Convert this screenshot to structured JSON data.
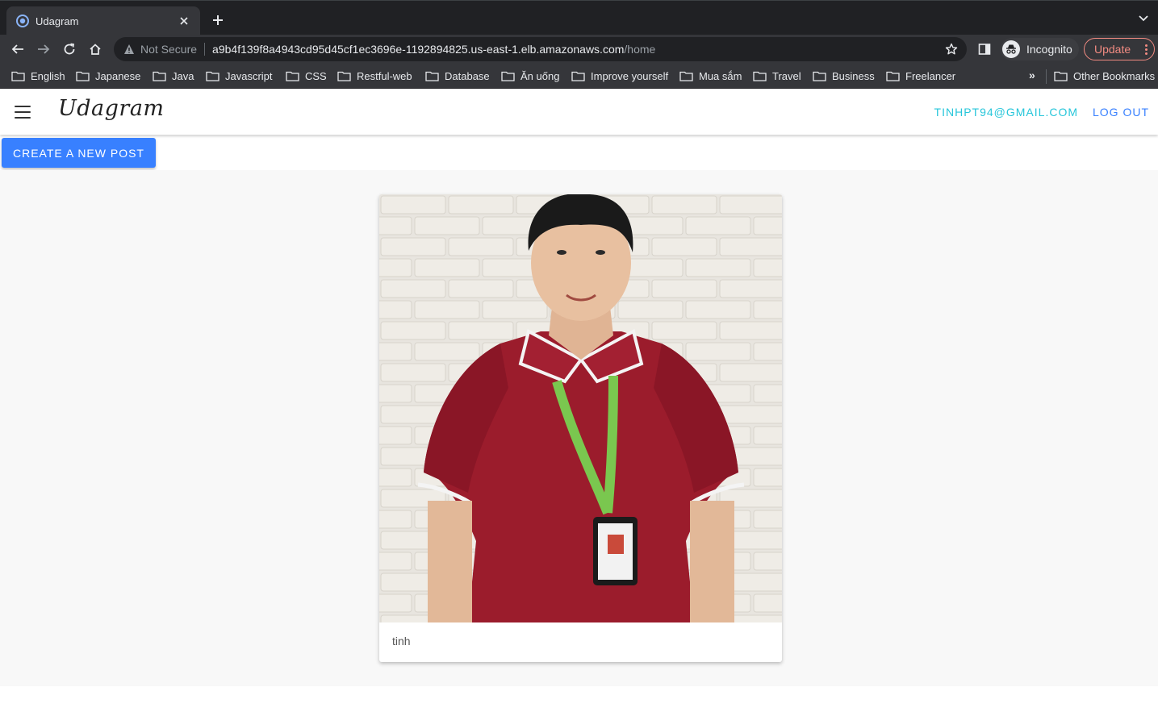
{
  "browser": {
    "tab_title": "Udagram",
    "security_label": "Not Secure",
    "url_host": "a9b4f139f8a4943cd95d45cf1ec3696e-1192894825.us-east-1.elb.amazonaws.com",
    "url_path": "/home",
    "profile_label": "Incognito",
    "update_label": "Update",
    "bookmarks": [
      "English",
      "Japanese",
      "Java",
      "Javascript",
      "CSS",
      "Restful-web",
      "Database",
      "Ăn uống",
      "Improve yourself",
      "Mua sắm",
      "Travel",
      "Business",
      "Freelancer"
    ],
    "more_bookmarks": "»",
    "other_bookmarks": "Other Bookmarks"
  },
  "app": {
    "brand": "Udagram",
    "user_email": "TINHPT94@GMAIL.COM",
    "logout_label": "LOG OUT",
    "create_post_label": "CREATE A NEW POST"
  },
  "feed": {
    "posts": [
      {
        "caption": "tinh"
      }
    ]
  },
  "colors": {
    "primary": "#3880ff",
    "secondary": "#26c6da",
    "chrome_dark": "#202124",
    "update_accent": "#f28b82"
  }
}
